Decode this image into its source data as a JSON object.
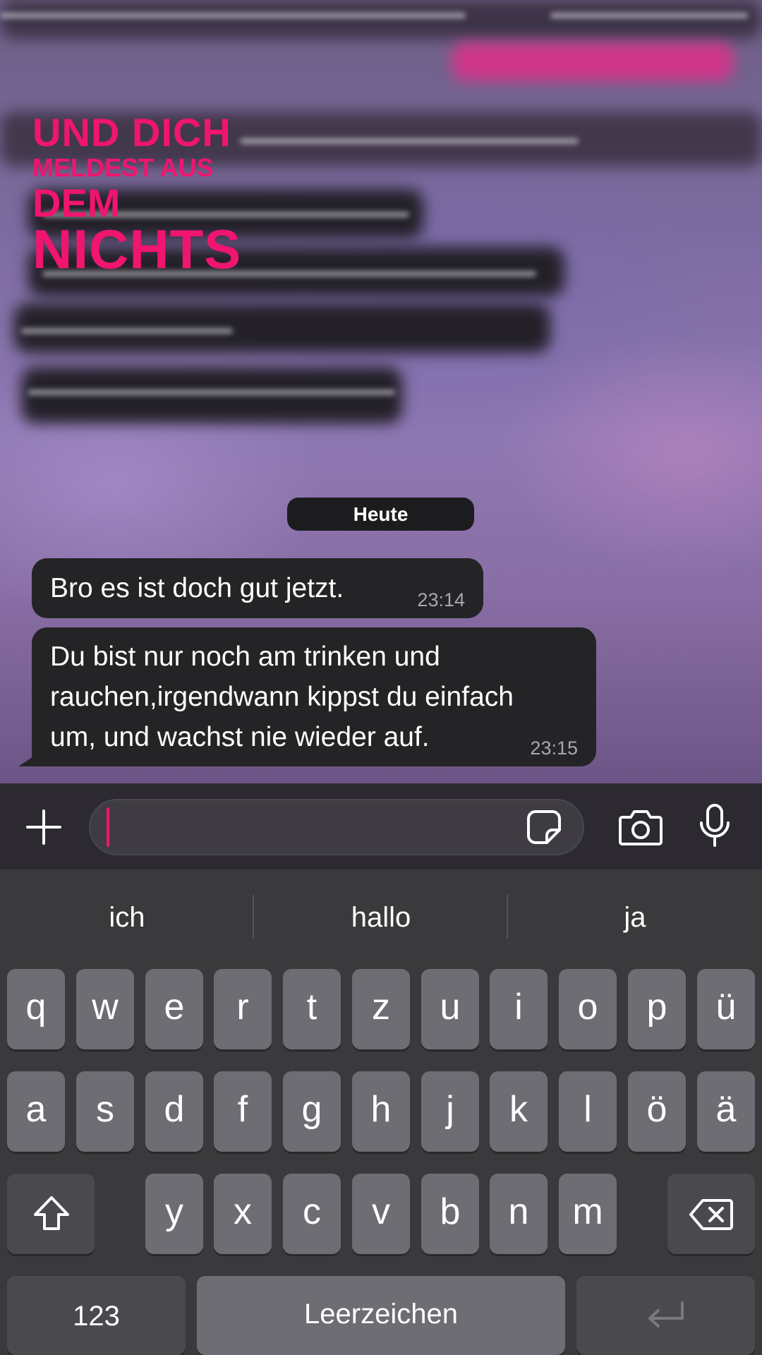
{
  "background": {
    "poster_lines": [
      "UND DICH",
      "MELDEST AUS",
      "DEM",
      "NICHTS"
    ],
    "accent_color": "#f0156f"
  },
  "chat": {
    "date_label": "Heute",
    "messages": [
      {
        "text": "Bro es ist doch gut jetzt.",
        "time": "23:14"
      },
      {
        "lines": [
          "Du bist nur noch am trinken und",
          "rauchen,irgendwann kippst du einfach",
          "um, und wachst nie wieder auf."
        ],
        "time": "23:15"
      }
    ]
  },
  "input_bar": {
    "icons": [
      "plus-icon",
      "sticker-icon",
      "camera-icon",
      "microphone-icon"
    ]
  },
  "keyboard": {
    "suggestions": [
      "ich",
      "hallo",
      "ja"
    ],
    "row1": [
      "q",
      "w",
      "e",
      "r",
      "t",
      "z",
      "u",
      "i",
      "o",
      "p",
      "ü"
    ],
    "row2": [
      "a",
      "s",
      "d",
      "f",
      "g",
      "h",
      "j",
      "k",
      "l",
      "ö",
      "ä"
    ],
    "row3": [
      "y",
      "x",
      "c",
      "v",
      "b",
      "n",
      "m"
    ],
    "numbers_key": "123",
    "space_key": "Leerzeichen",
    "icons": [
      "shift-icon",
      "backspace-icon",
      "return-icon"
    ]
  }
}
